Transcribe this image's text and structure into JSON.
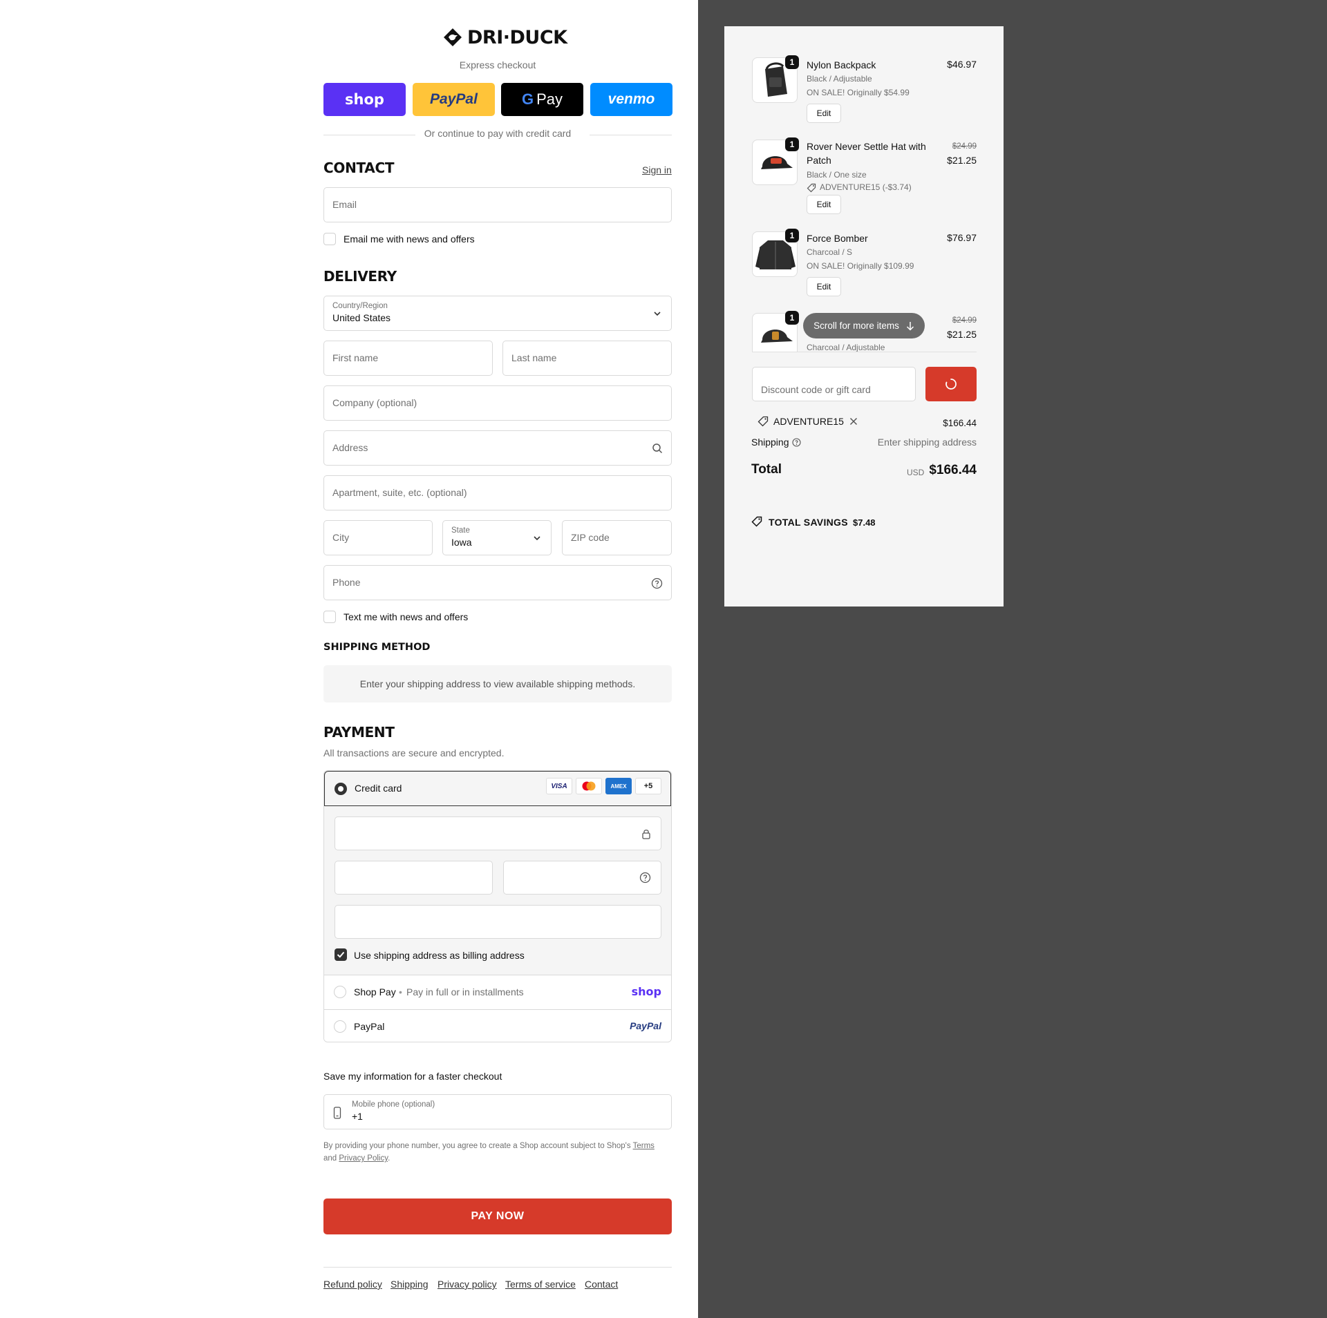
{
  "brand": {
    "name": "DRI·DUCK",
    "accent": "#d63a2a"
  },
  "express": {
    "label": "Express checkout",
    "buttons": [
      {
        "name": "shop",
        "label": "shop",
        "color": "#5a31f4"
      },
      {
        "name": "paypal",
        "label": "PayPal",
        "color": "#ffc439"
      },
      {
        "name": "gpay",
        "label": "Pay",
        "color": "#000000"
      },
      {
        "name": "venmo",
        "label": "venmo",
        "color": "#008cff"
      }
    ],
    "divider_text": "Or continue to pay with credit card"
  },
  "contact": {
    "title": "CONTACT",
    "sign_in": "Sign in",
    "email_placeholder": "Email",
    "news_label": "Email me with news and offers"
  },
  "delivery": {
    "title": "DELIVERY",
    "country_label": "Country/Region",
    "country_value": "United States",
    "first_name": "First name",
    "last_name": "Last name",
    "company": "Company (optional)",
    "address": "Address",
    "apartment": "Apartment, suite, etc. (optional)",
    "city": "City",
    "state_label": "State",
    "state_value": "Iowa",
    "zip": "ZIP code",
    "phone": "Phone",
    "text_news_label": "Text me with news and offers"
  },
  "shipping_method": {
    "title": "SHIPPING METHOD",
    "info": "Enter your shipping address to view available shipping methods."
  },
  "payment": {
    "title": "PAYMENT",
    "subtitle": "All transactions are secure and encrypted.",
    "credit_card_label": "Credit card",
    "card_logos": [
      "VISA",
      "AMEX",
      "+5"
    ],
    "billing_label": "Use shipping address as billing address",
    "shop_pay_label": "Shop Pay",
    "shop_pay_sub": "Pay in full or in installments",
    "shop_pay_logo": "shop",
    "paypal_label": "PayPal",
    "paypal_logo": "PayPal"
  },
  "save_info": {
    "title": "Save my information for a faster checkout",
    "phone_label": "Mobile phone (optional)",
    "phone_value": "+1",
    "legal_prefix": "By providing your phone number, you agree to create a Shop account subject to Shop's",
    "terms": "Terms",
    "and": "and",
    "privacy": "Privacy Policy",
    "period": "."
  },
  "pay_now": "PAY NOW",
  "footer": [
    "Refund policy",
    "Shipping",
    "Privacy policy",
    "Terms of service",
    "Contact"
  ],
  "cart": {
    "items": [
      {
        "qty": "1",
        "name": "Nylon Backpack",
        "variant": "Black / Adjustable",
        "note": "ON SALE! Originally $54.99",
        "price": "$46.97",
        "edit": "Edit"
      },
      {
        "qty": "1",
        "name": "Rover Never Settle Hat with Patch",
        "variant": "Black / One size",
        "discount": "ADVENTURE15 (-$3.74)",
        "original_price": "$24.99",
        "price": "$21.25",
        "edit": "Edit"
      },
      {
        "qty": "1",
        "name": "Force Bomber",
        "variant": "Charcoal / S",
        "note": "ON SALE! Originally $109.99",
        "price": "$76.97",
        "edit": "Edit"
      },
      {
        "qty": "1",
        "variant": "Charcoal / Adjustable",
        "original_price": "$24.99",
        "price": "$21.25"
      }
    ],
    "scroll_hint": "Scroll for more items",
    "discount_placeholder": "Discount code or gift card",
    "applied_code": "ADVENTURE15",
    "subtotal": "$166.44",
    "shipping_label": "Shipping",
    "shipping_value": "Enter shipping address",
    "total_label": "Total",
    "currency": "USD",
    "total": "$166.44",
    "savings_label": "TOTAL SAVINGS",
    "savings": "$7.48"
  }
}
